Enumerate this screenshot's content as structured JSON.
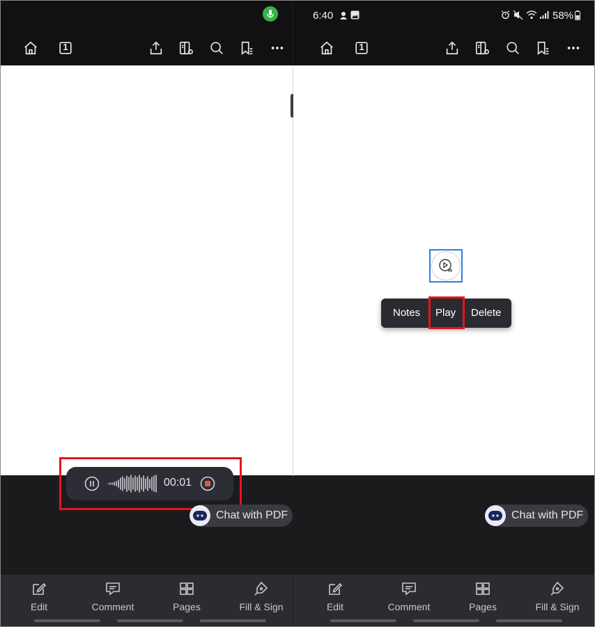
{
  "status_bar": {
    "time": "6:40",
    "battery": "58%"
  },
  "toolbar_icons": [
    "home-icon",
    "page-number-icon",
    "share-icon",
    "reader-mode-icon",
    "search-icon",
    "bookmarks-icon",
    "more-icon"
  ],
  "page_number": "1",
  "recorder": {
    "elapsed": "00:01",
    "accent_color": "#e5554f"
  },
  "context_menu": {
    "items": [
      "Notes",
      "Play",
      "Delete"
    ]
  },
  "chat_button": {
    "label": "Chat with PDF"
  },
  "bottom_nav": {
    "items": [
      "Edit",
      "Comment",
      "Pages",
      "Fill & Sign"
    ]
  },
  "colors": {
    "highlight": "#e8141c",
    "selection": "#2f7de1",
    "mic_indicator": "#36b24a"
  }
}
